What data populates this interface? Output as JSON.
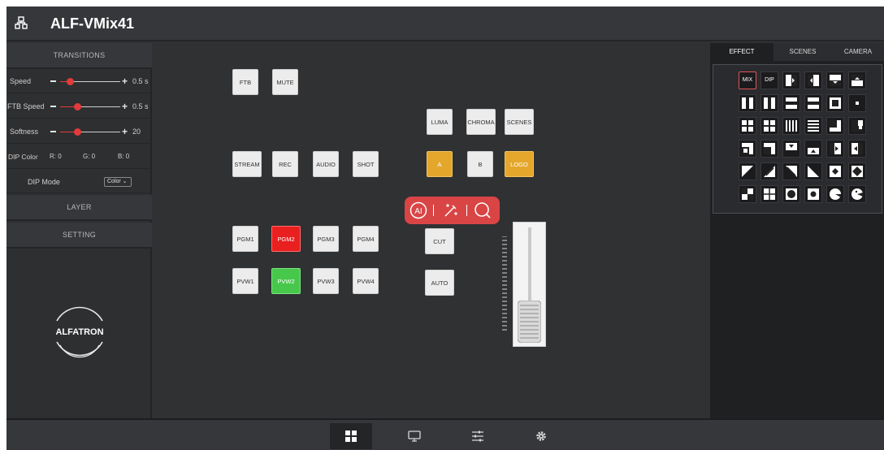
{
  "app": {
    "title": "ALF-VMix41",
    "brand_logo_text": "ALFATRON"
  },
  "left_panel": {
    "transitions_header": "TRANSITIONS",
    "speed": {
      "label": "Speed",
      "value": "0.5 s",
      "level": 0.15
    },
    "ftb_speed": {
      "label": "FTB Speed",
      "value": "0.5 s",
      "level": 0.3
    },
    "softness": {
      "label": "Softness",
      "value": "20",
      "level": 0.3
    },
    "dip_color": {
      "label": "DIP Color",
      "r": "R:  0",
      "g": "G:  0",
      "b": "B:  0"
    },
    "dip_mode": {
      "label": "DIP Mode",
      "selected": "Color"
    },
    "layer_header": "LAYER",
    "setting_header": "SETTING"
  },
  "center": {
    "ftb": "FTB",
    "mute": "MUTE",
    "luma": "LUMA",
    "chroma": "CHROMA",
    "scenes": "SCENES",
    "stream": "STREAM",
    "rec": "REC",
    "audio": "AUDIO",
    "shot": "SHOT",
    "a": "A",
    "b": "B",
    "logo": "LOGO",
    "pgm": [
      "PGM1",
      "PGM2",
      "PGM3",
      "PGM4"
    ],
    "pvw": [
      "PVW1",
      "PVW2",
      "PVW3",
      "PVW4"
    ],
    "cut": "CUT",
    "auto": "AUTO",
    "active_pgm": "PGM2",
    "active_pvw": "PVW2",
    "ai_toolbar": {
      "ai_label": "AI"
    },
    "colors": {
      "program": "#ea1f1f",
      "preview": "#47c84b",
      "keyer": "#e4a72b"
    }
  },
  "right_panel": {
    "tabs": [
      "EFFECT",
      "SCENES",
      "CAMERA"
    ],
    "active_tab": "EFFECT",
    "mix": "MIX",
    "dip": "DIP"
  },
  "bottom_nav": {
    "items": [
      "grid-icon",
      "monitor-icon",
      "sliders-icon",
      "gear-icon"
    ],
    "active": "grid-icon"
  }
}
